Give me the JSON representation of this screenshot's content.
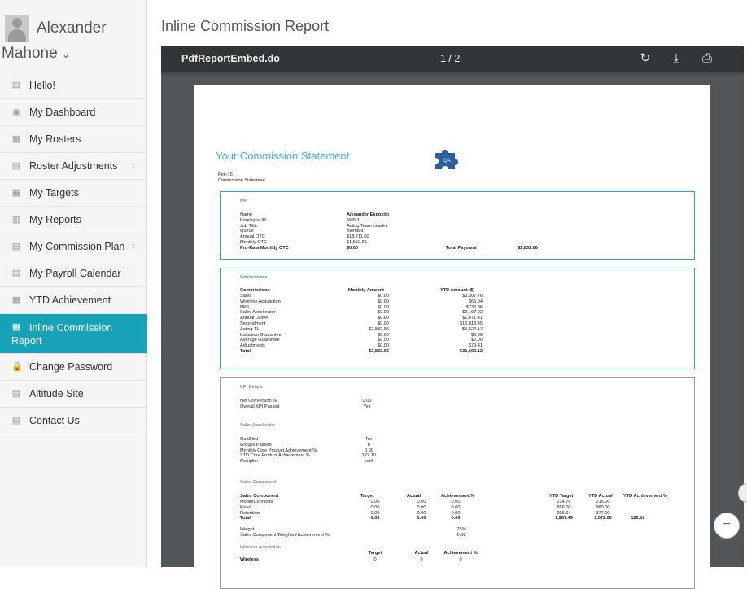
{
  "user": {
    "first": "Alexander",
    "last": "Mahone"
  },
  "nav": [
    {
      "label": "Hello!",
      "icon": "file-icon",
      "glyph": "▤",
      "chevron": false
    },
    {
      "label": "My Dashboard",
      "icon": "dashboard-icon",
      "glyph": "◉",
      "chevron": false
    },
    {
      "label": "My Rosters",
      "icon": "grid-icon",
      "glyph": "▦",
      "chevron": false
    },
    {
      "label": "Roster Adjustments",
      "icon": "file-icon",
      "glyph": "▤",
      "chevron": true
    },
    {
      "label": "My Targets",
      "icon": "grid-icon",
      "glyph": "▦",
      "chevron": false
    },
    {
      "label": "My Reports",
      "icon": "bar-chart-icon",
      "glyph": "▥",
      "chevron": false
    },
    {
      "label": "My Commission Plan",
      "icon": "file-icon",
      "glyph": "▤",
      "chevron": true
    },
    {
      "label": "My Payroll Calendar",
      "icon": "file-icon",
      "glyph": "▤",
      "chevron": false
    },
    {
      "label": "YTD Achievement",
      "icon": "grid-icon",
      "glyph": "▦",
      "chevron": false
    },
    {
      "label": "Inline Commission Report",
      "icon": "table-icon",
      "glyph": "▦",
      "chevron": false,
      "active": true
    },
    {
      "label": "Change Password",
      "icon": "lock-icon",
      "glyph": "🔒",
      "chevron": false
    },
    {
      "label": "Altitude Site",
      "icon": "file-icon",
      "glyph": "▤",
      "chevron": false
    },
    {
      "label": "Contact Us",
      "icon": "file-icon",
      "glyph": "▤",
      "chevron": false
    }
  ],
  "page_title": "Inline Commission Report",
  "viewer": {
    "title": "PdfReportEmbed.do",
    "page": "1 / 2",
    "icons": [
      "rotate-icon",
      "download-icon",
      "print-icon"
    ]
  },
  "colors": {
    "accent": "#17a2b8",
    "title_blue": "#3aaed8"
  },
  "doc": {
    "title": "Your Commission Statement",
    "date": "Feb-16",
    "subtitle": "Commission Statement",
    "me": {
      "header": "Me",
      "rows": [
        [
          "Name",
          "Alexander Esposito"
        ],
        [
          "Employee ID",
          "55904"
        ],
        [
          "Job Title",
          "Acting Team Leader"
        ],
        [
          "Queue",
          "Blended"
        ],
        [
          "Annual OTC",
          "$18,711.00"
        ],
        [
          "Monthly OTC",
          "$1,559.25"
        ],
        [
          "Pro-Rata Monthly OTC",
          "$0.00"
        ]
      ],
      "total_label": "Total Payment",
      "total_value": "$2,832.06"
    },
    "commissions": {
      "header": "Commissions",
      "cols": [
        "Commissions",
        "Monthly Amount",
        "YTD Amount ($)"
      ],
      "rows": [
        [
          "Sales",
          "$0.00",
          "$3,307.76"
        ],
        [
          "Wireless Acquisition",
          "$0.00",
          "$65.04"
        ],
        [
          "NPS",
          "$0.00",
          "$736.86"
        ],
        [
          "Sales Accelerator",
          "$0.00",
          "$3,197.02"
        ],
        [
          "Annual Leave",
          "$0.00",
          "$1,871.41"
        ],
        [
          "Secondment",
          "$0.00",
          "$16,818.45"
        ],
        [
          "Acting TL",
          "$2,832.06",
          "$5,524.17"
        ],
        [
          "Induction Guarantee",
          "$0.00",
          "$0.00"
        ],
        [
          "Average Guarantee",
          "$0.00",
          "$0.00"
        ],
        [
          "Adjustments",
          "$0.00",
          "$79.41"
        ],
        [
          "Total",
          "$2,832.06",
          "$31,600.12"
        ]
      ]
    },
    "kpi": {
      "header": "KPI Details",
      "rows": [
        [
          "Net Conversion %",
          "0.00"
        ],
        [
          "Overall KPI Passed",
          "Yes"
        ]
      ],
      "accel_header": "Sales Accelerator",
      "accel_rows": [
        [
          "Qualified",
          "No"
        ],
        [
          "Groups Passed",
          "0"
        ],
        [
          "Monthly Core Product Achievement %",
          "0.00"
        ],
        [
          "YTD Core Product Achievement %",
          "122.10"
        ],
        [
          "Multiplier",
          "null"
        ]
      ],
      "comp_header": "Sales Component",
      "comp_cols": [
        "Sales Component",
        "Target",
        "Actual",
        "Achievement %",
        "YTD Target",
        "YTD Actual",
        "YTD Achievement %"
      ],
      "comp_rows": [
        [
          "MobileConnects",
          "0.00",
          "0.00",
          "0.00",
          "224.76",
          "215.00",
          ""
        ],
        [
          "Fixed",
          "0.00",
          "0.00",
          "0.00",
          "856.00",
          "980.00",
          ""
        ],
        [
          "Retention",
          "0.00",
          "0.00",
          "0.00",
          "206.64",
          "377.00",
          ""
        ],
        [
          "Total",
          "0.00",
          "0.00",
          "0.00",
          "1,287.49",
          "1,572.00",
          "122.10"
        ]
      ],
      "weight_rows": [
        [
          "Weight",
          "75%"
        ],
        [
          "Sales Component Weighted Achievement %",
          "0.00"
        ]
      ],
      "wireless_header": "Wireless Acquisition",
      "wireless_cols": [
        "Target",
        "Actual",
        "Achievement %"
      ],
      "wireless_row": [
        "Wireless",
        "0",
        "0",
        "0"
      ]
    }
  }
}
